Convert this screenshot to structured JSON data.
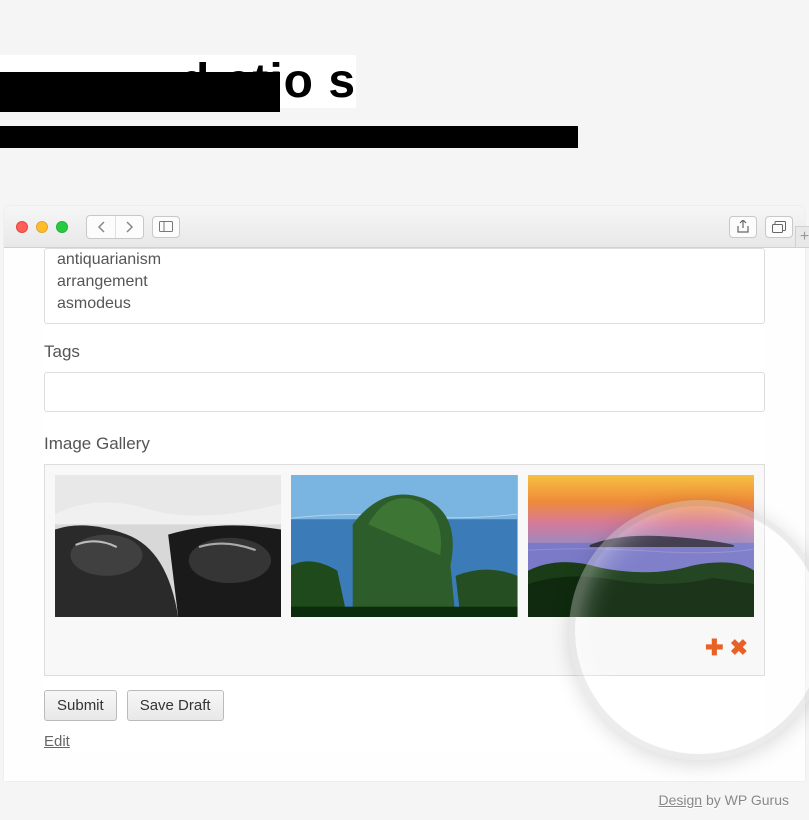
{
  "header": {
    "title_fragment": "d ctio s"
  },
  "categories": {
    "options": [
      "antiquarianism",
      "arrangement",
      "asmodeus"
    ]
  },
  "tags": {
    "label": "Tags",
    "value": ""
  },
  "gallery": {
    "label": "Image Gallery",
    "add_icon": "plus-icon",
    "remove_icon": "close-icon",
    "thumbs": [
      "bw-boats",
      "tropical-cliff",
      "sunset-coast"
    ]
  },
  "actions": {
    "submit": "Submit",
    "save_draft": "Save Draft",
    "edit": "Edit"
  },
  "footer": {
    "design": "Design",
    "by": " by WP Gurus"
  }
}
